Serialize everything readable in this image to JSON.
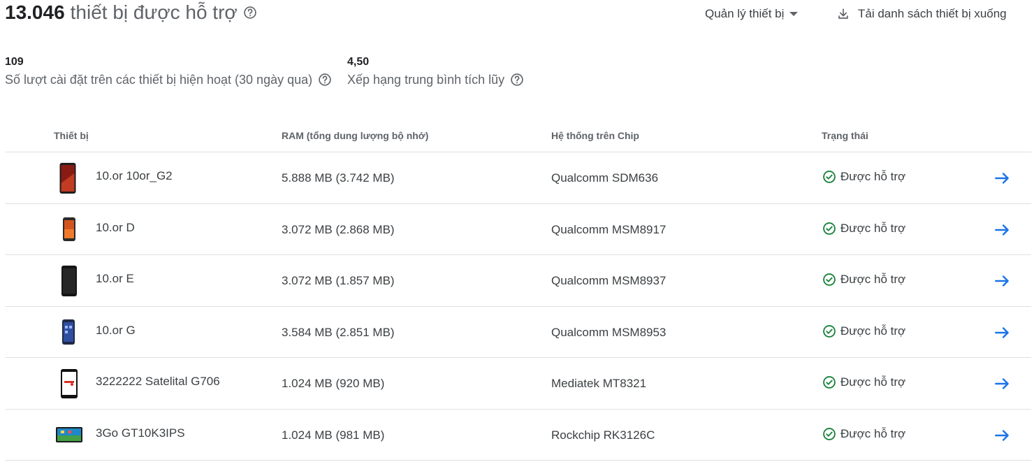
{
  "header": {
    "count": "13.046",
    "count_label": "thiết bị được hỗ trợ",
    "manage_label": "Quản lý thiết bị",
    "download_label": "Tải danh sách thiết bị xuống"
  },
  "stats": [
    {
      "value": "109",
      "label": "Số lượt cài đặt trên các thiết bị hiện hoạt (30 ngày qua)"
    },
    {
      "value": "4,50",
      "label": "Xếp hạng trung bình tích lũy"
    }
  ],
  "table": {
    "columns": [
      "Thiết bị",
      "RAM (tổng dung lượng bộ nhớ)",
      "Hệ thống trên Chip",
      "Trạng thái"
    ],
    "rows": [
      {
        "name": "10.or 10or_G2",
        "ram": "5.888 MB (3.742 MB)",
        "soc": "Qualcomm SDM636",
        "status": "Được hỗ trợ"
      },
      {
        "name": "10.or D",
        "ram": "3.072 MB (2.868 MB)",
        "soc": "Qualcomm MSM8917",
        "status": "Được hỗ trợ"
      },
      {
        "name": "10.or E",
        "ram": "3.072 MB (1.857 MB)",
        "soc": "Qualcomm MSM8937",
        "status": "Được hỗ trợ"
      },
      {
        "name": "10.or G",
        "ram": "3.584 MB (2.851 MB)",
        "soc": "Qualcomm MSM8953",
        "status": "Được hỗ trợ"
      },
      {
        "name": "3222222 Satelital G706",
        "ram": "1.024 MB (920 MB)",
        "soc": "Mediatek MT8321",
        "status": "Được hỗ trợ"
      },
      {
        "name": "3Go GT10K3IPS",
        "ram": "1.024 MB (981 MB)",
        "soc": "Rockchip RK3126C",
        "status": "Được hỗ trợ"
      }
    ]
  },
  "icons": {
    "help": "help-circle-icon",
    "download": "download-icon",
    "status": "check-circle-icon",
    "arrow": "arrow-forward-icon"
  },
  "colors": {
    "supported": "#188038",
    "link": "#1a73e8"
  }
}
